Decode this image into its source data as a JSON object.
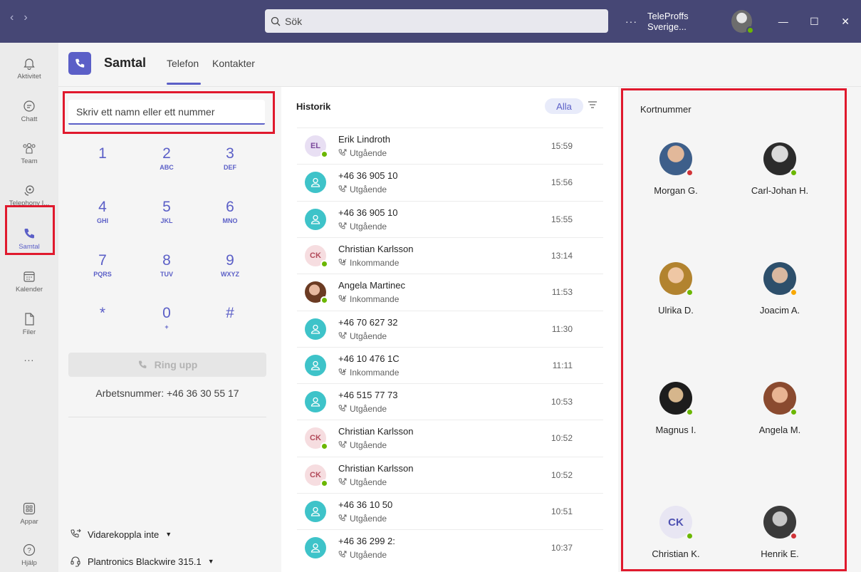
{
  "titlebar": {
    "nav_back": "‹",
    "nav_forward": "›",
    "search_placeholder": "Sök",
    "more": "···",
    "org_name": "TeleProffs Sverige...",
    "minimize": "—",
    "maximize": "☐",
    "close": "✕"
  },
  "rail": {
    "items": [
      {
        "label": "Aktivitet",
        "icon": "bell-icon"
      },
      {
        "label": "Chatt",
        "icon": "chat-icon"
      },
      {
        "label": "Team",
        "icon": "team-icon"
      },
      {
        "label": "Telephony I...",
        "icon": "telephony-icon"
      },
      {
        "label": "Samtal",
        "icon": "phone-icon",
        "active": true
      },
      {
        "label": "Kalender",
        "icon": "calendar-icon"
      },
      {
        "label": "Filer",
        "icon": "file-icon"
      },
      {
        "label": "...",
        "icon": "more-icon"
      },
      {
        "label": "Appar",
        "icon": "apps-icon"
      },
      {
        "label": "Hjälp",
        "icon": "help-icon"
      }
    ]
  },
  "header": {
    "title": "Samtal",
    "tabs": [
      {
        "label": "Telefon",
        "active": true
      },
      {
        "label": "Kontakter"
      }
    ]
  },
  "dialpad": {
    "input_placeholder": "Skriv ett namn eller ett nummer",
    "keys": [
      {
        "num": "1",
        "letters": ""
      },
      {
        "num": "2",
        "letters": "ABC"
      },
      {
        "num": "3",
        "letters": "DEF"
      },
      {
        "num": "4",
        "letters": "GHI"
      },
      {
        "num": "5",
        "letters": "JKL"
      },
      {
        "num": "6",
        "letters": "MNO"
      },
      {
        "num": "7",
        "letters": "PQRS"
      },
      {
        "num": "8",
        "letters": "TUV"
      },
      {
        "num": "9",
        "letters": "WXYZ"
      },
      {
        "num": "*",
        "letters": ""
      },
      {
        "num": "0",
        "letters": "+"
      },
      {
        "num": "#",
        "letters": ""
      }
    ],
    "call_label": "Ring upp",
    "work_number": "Arbetsnummer: +46 36 30 55 17",
    "forwarding": "Vidarekoppla inte",
    "device": "Plantronics Blackwire 315.1"
  },
  "history": {
    "title": "Historik",
    "filter": "Alla",
    "rows": [
      {
        "name": "Erik Lindroth",
        "type": "Utgående",
        "time": "15:59",
        "avatar": "EL",
        "style": "purple"
      },
      {
        "name": "+46 36 905 10",
        "type": "Utgående",
        "time": "15:56",
        "avatar": "",
        "style": "teal"
      },
      {
        "name": "+46 36 905 10",
        "type": "Utgående",
        "time": "15:55",
        "avatar": "",
        "style": "teal"
      },
      {
        "name": "Christian Karlsson",
        "type": "Inkommande",
        "time": "13:14",
        "avatar": "CK",
        "style": "pink"
      },
      {
        "name": "Angela Martinec",
        "type": "Inkommande",
        "time": "11:53",
        "avatar": "",
        "style": "photo"
      },
      {
        "name": "+46 70 627 32",
        "type": "Utgående",
        "time": "11:30",
        "avatar": "",
        "style": "teal"
      },
      {
        "name": "+46 10 476 1C",
        "type": "Inkommande",
        "time": "11:11",
        "avatar": "",
        "style": "teal"
      },
      {
        "name": "+46 515 77 73",
        "type": "Utgående",
        "time": "10:53",
        "avatar": "",
        "style": "teal"
      },
      {
        "name": "Christian Karlsson",
        "type": "Utgående",
        "time": "10:52",
        "avatar": "CK",
        "style": "pink"
      },
      {
        "name": "Christian Karlsson",
        "type": "Utgående",
        "time": "10:52",
        "avatar": "CK",
        "style": "pink"
      },
      {
        "name": "+46 36 10 50",
        "type": "Utgående",
        "time": "10:51",
        "avatar": "",
        "style": "teal"
      },
      {
        "name": "+46 36 299 2:",
        "type": "Utgående",
        "time": "10:37",
        "avatar": "",
        "style": "teal"
      }
    ]
  },
  "speeddial": {
    "title": "Kortnummer",
    "contacts": [
      {
        "name": "Morgan G.",
        "presence": "#d13438"
      },
      {
        "name": "Carl-Johan H.",
        "presence": "#6bb700"
      },
      {
        "name": "Ulrika D.",
        "presence": "#6bb700"
      },
      {
        "name": "Joacim A.",
        "presence": "#f8a800"
      },
      {
        "name": "Magnus I.",
        "presence": "#6bb700"
      },
      {
        "name": "Angela M.",
        "presence": "#6bb700"
      },
      {
        "name": "Christian K.",
        "presence": "#6bb700",
        "initials": "CK"
      },
      {
        "name": "Henrik E.",
        "presence": "#d13438"
      }
    ]
  },
  "colors": {
    "accent": "#5b5fc7",
    "titlebar": "#464775",
    "highlight": "#e0192d",
    "teal": "#3ec3c9"
  }
}
